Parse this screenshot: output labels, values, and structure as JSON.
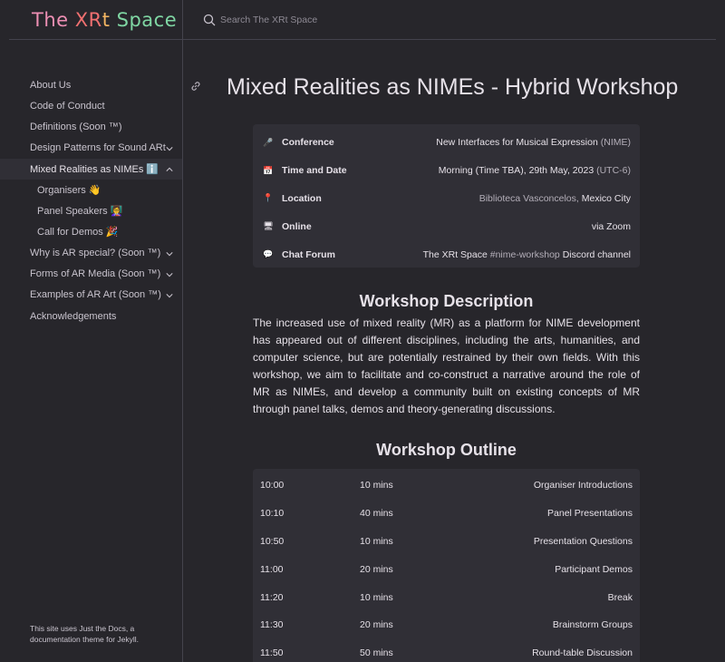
{
  "site": {
    "title_parts": [
      "The ",
      "XR",
      "t",
      " Space"
    ],
    "search_placeholder": "Search The XRt Space"
  },
  "sidebar": {
    "items": [
      {
        "label": "About Us",
        "expandable": false
      },
      {
        "label": "Code of Conduct",
        "expandable": false
      },
      {
        "label": "Definitions (Soon ™)",
        "expandable": false
      },
      {
        "label": "Design Patterns for Sound ARt",
        "expandable": true
      },
      {
        "label": "Mixed Realities as NIMEs ℹ️",
        "expandable": true,
        "expanded": true
      },
      {
        "label": "Organisers 👋",
        "sub": true
      },
      {
        "label": "Panel Speakers 👩‍🏫",
        "sub": true
      },
      {
        "label": "Call for Demos 🎉",
        "sub": true
      },
      {
        "label": "Why is AR special? (Soon ™)",
        "expandable": true
      },
      {
        "label": "Forms of AR Media (Soon ™)",
        "expandable": true
      },
      {
        "label": "Examples of AR Art (Soon ™)",
        "expandable": true
      },
      {
        "label": "Acknowledgements",
        "expandable": false
      }
    ],
    "footer_note": "This site uses Just the Docs, a documentation theme for Jekyll."
  },
  "main": {
    "title": "Mixed Realities as NIMEs - Hybrid Workshop",
    "info": [
      {
        "icon": "🎤",
        "label": "Conference",
        "value_main": "New Interfaces for Musical Expression",
        "value_muted": " (NIME)"
      },
      {
        "icon": "📅",
        "label": "Time and Date",
        "value_main": "Morning (Time TBA), 29th May, 2023",
        "value_muted": " (UTC-6)"
      },
      {
        "icon": "📍",
        "label": "Location",
        "value_muted_pre": "Biblioteca Vasconcelos, ",
        "value_main": "Mexico City"
      },
      {
        "icon": "🖥",
        "label": "Online",
        "value_main": "via Zoom"
      },
      {
        "icon": "💬",
        "label": "Chat Forum",
        "value_main": "The XRt Space ",
        "value_muted": "#nime-workshop",
        "value_tail": " Discord channel"
      }
    ],
    "description_title": "Workshop Description",
    "description": "The increased use of mixed reality (MR) as a platform for NIME development has appeared out of different disciplines, including the arts, humanities, and computer science, but are potentially restrained by their own fields. With this workshop, we aim to facilitate and co-construct a narrative around the role of MR as NIMEs, and develop a community built on existing concepts of MR through panel talks, demos and theory-generating discussions.",
    "outline_title": "Workshop Outline",
    "outline": [
      {
        "time": "10:00",
        "duration": "10 mins",
        "activity": "Organiser Introductions"
      },
      {
        "time": "10:10",
        "duration": "40 mins",
        "activity": "Panel Presentations"
      },
      {
        "time": "10:50",
        "duration": "10 mins",
        "activity": "Presentation Questions"
      },
      {
        "time": "11:00",
        "duration": "20 mins",
        "activity": "Participant Demos"
      },
      {
        "time": "11:20",
        "duration": "10 mins",
        "activity": "Break"
      },
      {
        "time": "11:30",
        "duration": "20 mins",
        "activity": "Brainstorm Groups"
      },
      {
        "time": "11:50",
        "duration": "50 mins",
        "activity": "Round-table Discussion"
      }
    ]
  },
  "colors": {
    "background": "#27262b",
    "card": "#302f36",
    "title_pink": "#ee8fb4",
    "title_red": "#f07070",
    "title_orange": "#f3b562",
    "title_green": "#7fd6a3"
  }
}
